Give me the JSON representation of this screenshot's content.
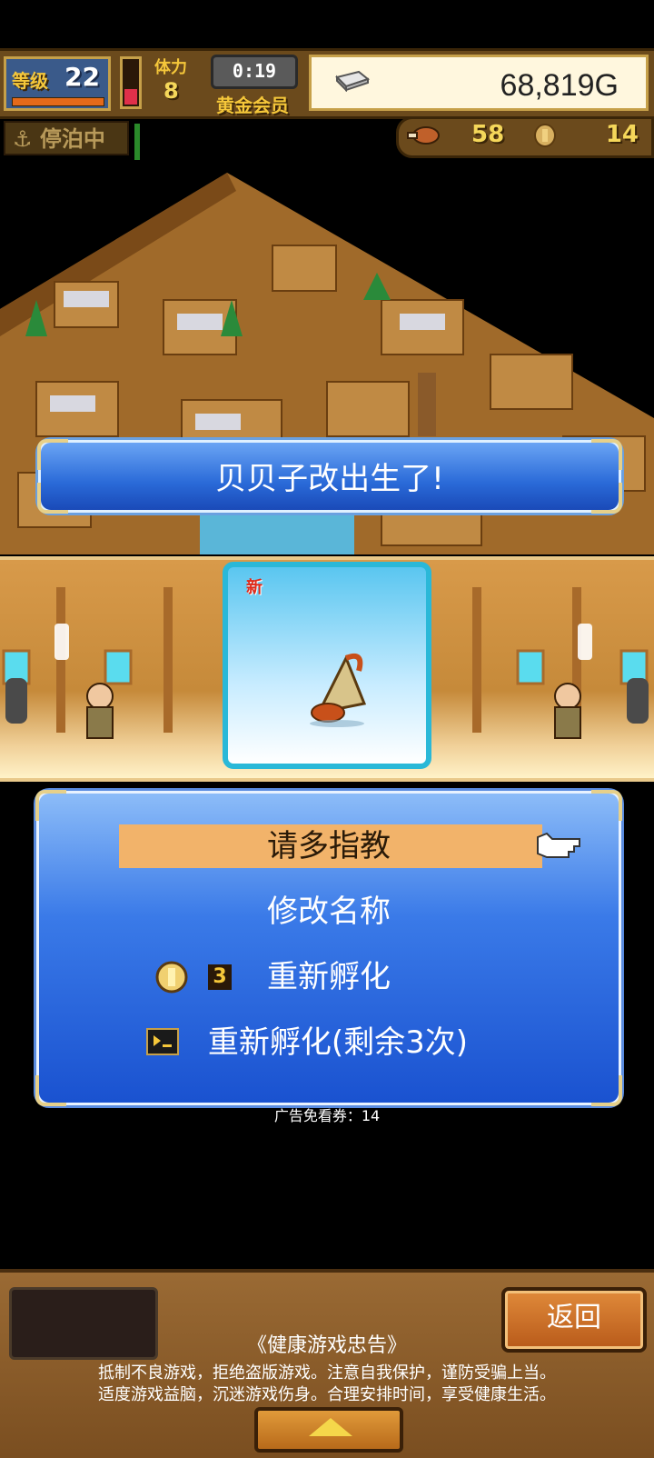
{
  "hud": {
    "level_label": "等级",
    "level_value": "22",
    "stamina_label": "体力",
    "stamina_value": "8",
    "stamina_fill": 0.35,
    "timer": "0:19",
    "membership": "黄金会员",
    "money": "68,819G",
    "status": "停泊中",
    "food_count": "58",
    "coin_count": "14"
  },
  "banner": {
    "text": "贝贝子改出生了!"
  },
  "card": {
    "new_badge": "新"
  },
  "menu": {
    "item_greet": "请多指教",
    "item_rename": "修改名称",
    "item_rehatch_coin": "重新孵化",
    "rehatch_coin_cost": "3",
    "item_rehatch_ad": "重新孵化(剩余3次)"
  },
  "ad_ticket": "广告免看券：14",
  "bottom": {
    "back_label": "返回",
    "notice_title": "《健康游戏忠告》",
    "notice_line1": "抵制不良游戏，拒绝盗版游戏。注意自我保护，谨防受骗上当。",
    "notice_line2": "适度游戏益脑，沉迷游戏伤身。合理安排时间，享受健康生活。"
  },
  "colors": {
    "panel_blue": "#2a6ad8",
    "selected_item": "#f2b36a",
    "gold_text": "#f5c73a"
  }
}
